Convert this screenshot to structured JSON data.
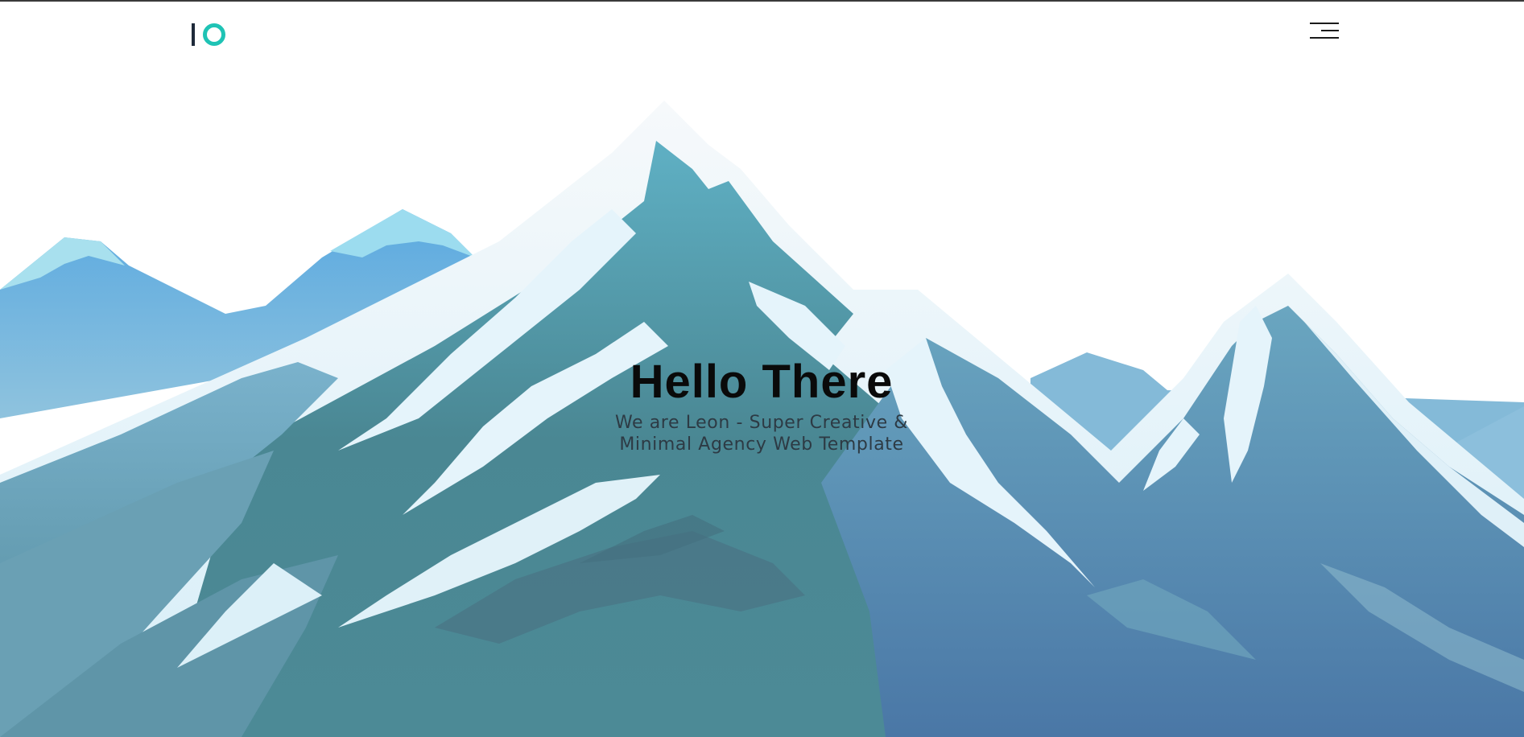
{
  "header": {
    "logo_icon": "io-logo-mark",
    "menu_icon": "hamburger-menu-icon",
    "accent_color": "#1fc3b5"
  },
  "hero": {
    "title": "Hello There",
    "subtitle_line1": "We are Leon - Super Creative &",
    "subtitle_line2": "Minimal Agency Web Template"
  },
  "background": {
    "illustration": "snowy-mountain-range",
    "sky_color": "#ffffff",
    "rock_color": "#4a8a96",
    "snow_color": "#e6f4fa"
  }
}
